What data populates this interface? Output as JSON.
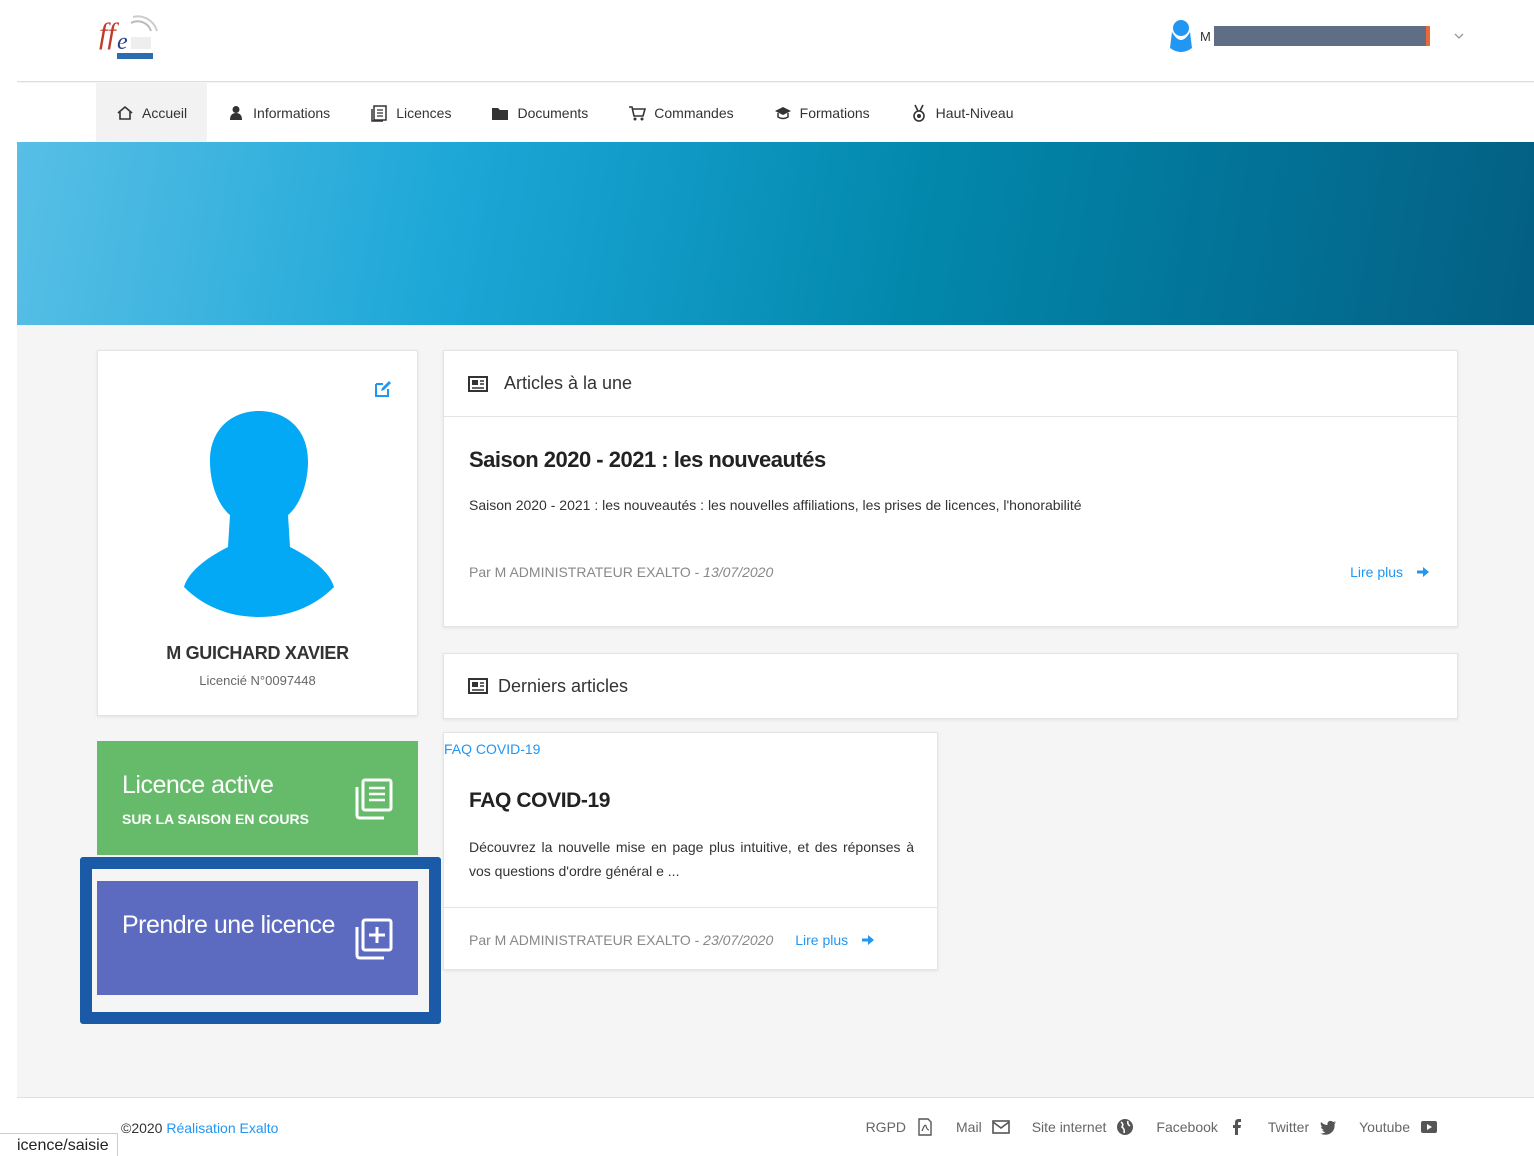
{
  "header": {
    "logo_alt": "ffe",
    "user_initial": "M"
  },
  "nav": [
    {
      "label": "Accueil"
    },
    {
      "label": "Informations"
    },
    {
      "label": "Licences"
    },
    {
      "label": "Documents"
    },
    {
      "label": "Commandes"
    },
    {
      "label": "Formations"
    },
    {
      "label": "Haut-Niveau"
    }
  ],
  "profile": {
    "name": "M GUICHARD XAVIER",
    "licence": "Licencié N°0097448"
  },
  "tiles": {
    "active_title": "Licence active",
    "active_sub": "SUR LA SAISON EN COURS",
    "take_title": "Prendre une licence"
  },
  "featured": {
    "heading": "Articles à la une",
    "title": "Saison 2020 - 2021 : les nouveautés",
    "desc": "Saison 2020 - 2021 :  les nouveautés : les nouvelles affiliations, les prises de licences,  l'honorabilité",
    "meta_prefix": "Par M ADMINISTRATEUR EXALTO - ",
    "date": "13/07/2020",
    "read_more": "Lire plus"
  },
  "latest": {
    "heading": "Derniers articles",
    "tag": "FAQ COVID-19",
    "title": "FAQ COVID-19",
    "desc": "Découvrez la nouvelle mise en page plus intuitive, et des réponses à vos questions d'ordre général e ...",
    "meta_prefix": "Par M ADMINISTRATEUR EXALTO - ",
    "date": "23/07/2020",
    "read_more": "Lire plus"
  },
  "footer": {
    "copy_prefix": "©2020 ",
    "copy_link": "Réalisation Exalto",
    "links": [
      "RGPD",
      "Mail",
      "Site internet",
      "Facebook",
      "Twitter",
      "Youtube"
    ]
  },
  "status_url": "icence/saisie",
  "colors": {
    "accent": "#2196f3",
    "green_tile": "#66bb6a",
    "purple_tile": "#5c6bc0",
    "highlight": "#1b5aa6"
  }
}
